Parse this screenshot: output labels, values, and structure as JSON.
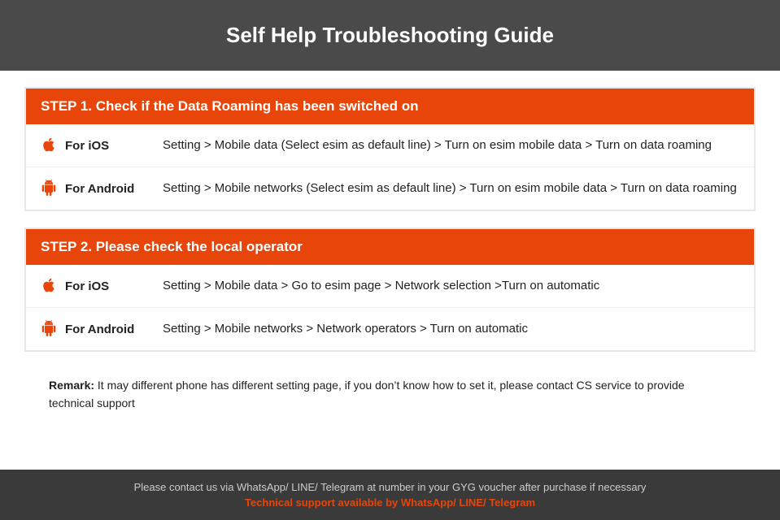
{
  "header": {
    "title": "Self Help Troubleshooting Guide"
  },
  "step1": {
    "header": "STEP 1.  Check if the Data Roaming has been switched on",
    "ios_label": "For iOS",
    "ios_text": "Setting > Mobile data (Select esim as default line) > Turn on esim mobile data > Turn on data roaming",
    "android_label": "For Android",
    "android_text": "Setting > Mobile networks (Select esim as default line) > Turn on esim mobile data > Turn on data roaming"
  },
  "step2": {
    "header": "STEP 2.  Please check the local operator",
    "ios_label": "For iOS",
    "ios_text": "Setting > Mobile data > Go to esim page > Network selection >Turn on automatic",
    "android_label": "For Android",
    "android_text": "Setting > Mobile networks > Network operators > Turn on automatic"
  },
  "remark": {
    "label": "Remark:",
    "text": " It may different phone has different setting page, if you don’t know how to set it,  please contact CS service to provide technical support"
  },
  "footer": {
    "text": "Please contact us via WhatsApp/ LINE/ Telegram at number in your GYG voucher after purchase if necessary",
    "support_text": "Technical support available by WhatsApp/ LINE/ Telegram"
  }
}
